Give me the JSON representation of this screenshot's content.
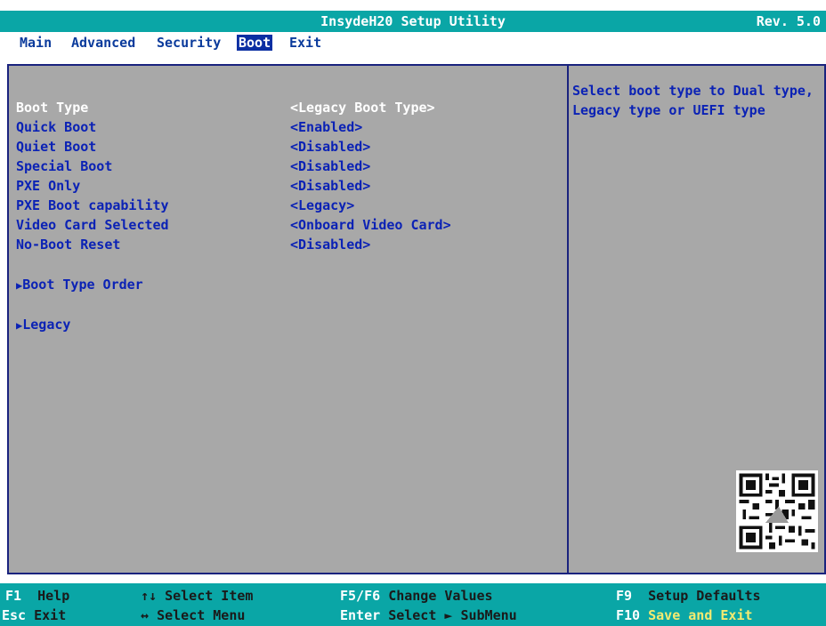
{
  "header": {
    "title": "InsydeH20 Setup Utility",
    "revision": "Rev. 5.0"
  },
  "tabs": [
    {
      "label": "Main"
    },
    {
      "label": "Advanced"
    },
    {
      "label": "Security"
    },
    {
      "label": "Boot"
    },
    {
      "label": "Exit"
    }
  ],
  "settings": [
    {
      "label": "Boot Type",
      "value": "<Legacy Boot Type>"
    },
    {
      "label": "Quick Boot",
      "value": "<Enabled>"
    },
    {
      "label": "Quiet Boot",
      "value": "<Disabled>"
    },
    {
      "label": "Special Boot",
      "value": "<Disabled>"
    },
    {
      "label": "PXE Only",
      "value": "<Disabled>"
    },
    {
      "label": "PXE Boot capability",
      "value": "<Legacy>"
    },
    {
      "label": "Video Card Selected",
      "value": "<Onboard Video Card>"
    },
    {
      "label": "No-Boot Reset",
      "value": "<Disabled>"
    }
  ],
  "submenus": [
    {
      "label": "Boot Type Order"
    },
    {
      "label": "Legacy"
    }
  ],
  "help": {
    "line1": "Select boot type to Dual type,",
    "line2": "Legacy type or UEFI type"
  },
  "footer": {
    "f1_key": "F1",
    "f1_label": "Help",
    "updown_key": "↑↓",
    "updown_label": "Select Item",
    "f5f6_key": "F5/F6",
    "f5f6_label": "Change Values",
    "f9_key": "F9",
    "f9_label": "Setup Defaults",
    "esc_key": "Esc",
    "esc_label": "Exit",
    "leftright_key": "↔",
    "leftright_label": "Select Menu",
    "enter_key": "Enter",
    "enter_label": "Select ► SubMenu",
    "f10_key": "F10",
    "f10_label": "Save and Exit"
  },
  "colors": {
    "title_bar": "#0aa6a6",
    "panel_bg": "#a8a8a8",
    "text_blue": "#0b22b5",
    "selected_text": "#ffffff",
    "active_tab_bg": "#0b2fa3",
    "footer_highlight": "#f4ea70"
  },
  "icons": {
    "submenu": "triangle-right-icon",
    "qr": "qr-code-icon"
  }
}
